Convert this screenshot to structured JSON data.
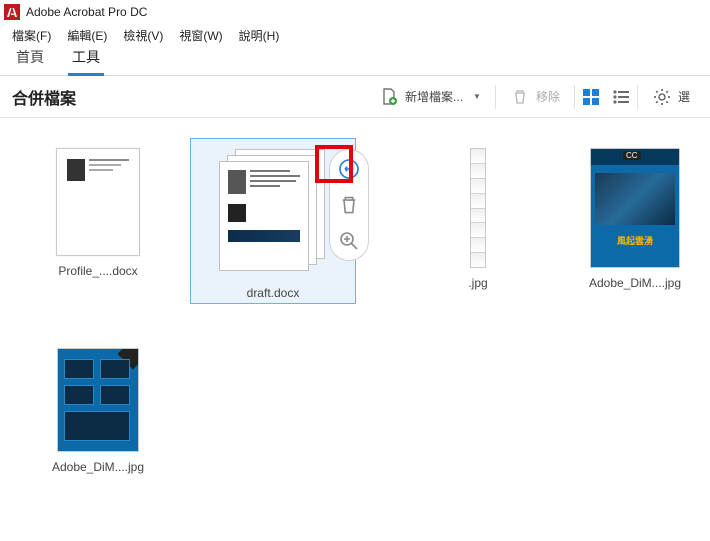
{
  "app": {
    "title": "Adobe Acrobat Pro DC"
  },
  "menu": {
    "items": [
      "檔案(F)",
      "編輯(E)",
      "檢視(V)",
      "視窗(W)",
      "說明(H)"
    ]
  },
  "tabs": {
    "items": [
      "首頁",
      "工具"
    ],
    "activeIndex": 1
  },
  "toolbar": {
    "title": "合併檔案",
    "add_label": "新增檔案...",
    "remove_label": "移除",
    "options_label": "選"
  },
  "files": [
    {
      "caption": "Profile_....docx"
    },
    {
      "caption": "draft.docx"
    },
    {
      "caption": ".jpg"
    },
    {
      "caption": "Adobe_DiM....jpg"
    },
    {
      "caption": "Adobe_DiM....jpg"
    }
  ],
  "poster": {
    "cc": "CC",
    "headline": "風起雲湧"
  }
}
